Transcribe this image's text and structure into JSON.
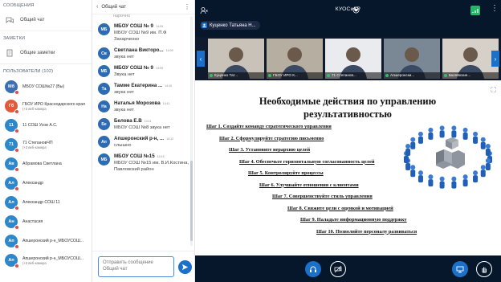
{
  "sidebar": {
    "messages_header": "СООБЩЕНИЯ",
    "public_chat": "Общий чат",
    "notes_header": "ЗАМЕТКИ",
    "shared_notes": "Общие заметки",
    "users_header": "ПОЛЬЗОВАТЕЛИ (102)",
    "users": [
      {
        "initials": "Мб",
        "name": "МБОУ СОШ№27 (Вы)",
        "sub": "",
        "color": "#3b6fb0"
      },
      {
        "initials": "Гб",
        "name": "ГБОУ ИРО Краснодарского края",
        "sub": "(+3 веб-камера",
        "color": "#e25a3a"
      },
      {
        "initials": "11",
        "name": "11 СОШ Усов А.С.",
        "sub": "",
        "color": "#2e87c8"
      },
      {
        "initials": "71",
        "name": "71 СтепановЧП",
        "sub": "(+3 веб-камера",
        "color": "#2e87c8"
      },
      {
        "initials": "Ав",
        "name": "Абрамова Светлана",
        "sub": "",
        "color": "#2e87c8"
      },
      {
        "initials": "Ал",
        "name": "Александр",
        "sub": "",
        "color": "#2e87c8"
      },
      {
        "initials": "Ал",
        "name": "Александр СОШ 11",
        "sub": "",
        "color": "#2e87c8"
      },
      {
        "initials": "Ан",
        "name": "Анастасия",
        "sub": "",
        "color": "#2e87c8"
      },
      {
        "initials": "Ап",
        "name": "Апшеронский р-н_МБОУСОШ...",
        "sub": "",
        "color": "#2e87c8"
      },
      {
        "initials": "Ап",
        "name": "Апшеронский р-н_МБОУСОШ...",
        "sub": "(+3 веб-камера",
        "color": "#2e87c8"
      }
    ]
  },
  "chat": {
    "back_label": "<",
    "title": "Общий чат",
    "top_fragment": "нарочно",
    "messages": [
      {
        "initials": "МБ",
        "name": "МБОУ СОШ № 9",
        "time": "14:09",
        "text": "МБОУ СОШ №9 им. П.Ф Захарченко",
        "color": "#2e6bb5"
      },
      {
        "initials": "Св",
        "name": "Светлана Викторо...",
        "time": "14:09",
        "text": "звука нет",
        "color": "#2e6bb5"
      },
      {
        "initials": "МБ",
        "name": "МБОУ СОШ № 9",
        "time": "14:09",
        "text": "Звука нет",
        "color": "#2e6bb5"
      },
      {
        "initials": "Та",
        "name": "Тамме Екатерина ...",
        "time": "14:10",
        "text": "звука нет",
        "color": "#2e6bb5"
      },
      {
        "initials": "На",
        "name": "Наталья Морозова",
        "time": "14:11",
        "text": "звука нет",
        "color": "#2e6bb5"
      },
      {
        "initials": "Бе",
        "name": "Белова Е.В",
        "time": "14:11",
        "text": "МБОУ СОШ №8 звука нет",
        "color": "#2e6bb5"
      },
      {
        "initials": "Ап",
        "name": "Апшеронский р-н, ...",
        "time": "14:12",
        "text": "слышно",
        "color": "#2e6bb5"
      },
      {
        "initials": "МБ",
        "name": "МБОУ СОШ №15",
        "time": "14:15",
        "text": "МБОУ СОШ №15 им. В.И.Костина, Павловский район",
        "color": "#2e6bb5"
      }
    ],
    "input_placeholder": "Отправить сообщение Общий чат"
  },
  "main": {
    "title": "КУОСиКР",
    "presenter": "Куценко Татьяна Н...",
    "videos": [
      {
        "label": "Куценко Тат...",
        "bg": "#c9c2b8"
      },
      {
        "label": "ГБОУ ИРО К...",
        "bg": "#b6aea0"
      },
      {
        "label": "71 Степанов...",
        "bg": "#e9ebee"
      },
      {
        "label": "Апшеронски...",
        "bg": "#7a8795"
      },
      {
        "label": "Бюлявские...",
        "bg": "#d7d0c8"
      }
    ],
    "slide": {
      "title": "Необходимые действия по управлению результативностью",
      "steps": [
        "Шаг 1. Создайте команду стратегического управления",
        "Шаг 2. Сформулируйте стратегию письменно",
        "Шаг 3. Установите иерархию целей",
        "Шаг 4. Обеспечьте горизонтальную согласованность целей",
        "Шаг 5. Контролируйте процессы",
        "Шаг 6. Улучшайте отношения с клиентами",
        "Шаг 7. Совершенствуйте стиль управления",
        "Шаг 8. Свяжите цели с оценкой и мотивацией",
        "Шаг 9. Наладьте информационную поддержку",
        "Шаг 10. Позволяйте персоналу развиваться"
      ]
    }
  },
  "colors": {
    "topbar": "#06172b",
    "accent": "#1b70c9",
    "mic_active": "#1b70c9"
  }
}
